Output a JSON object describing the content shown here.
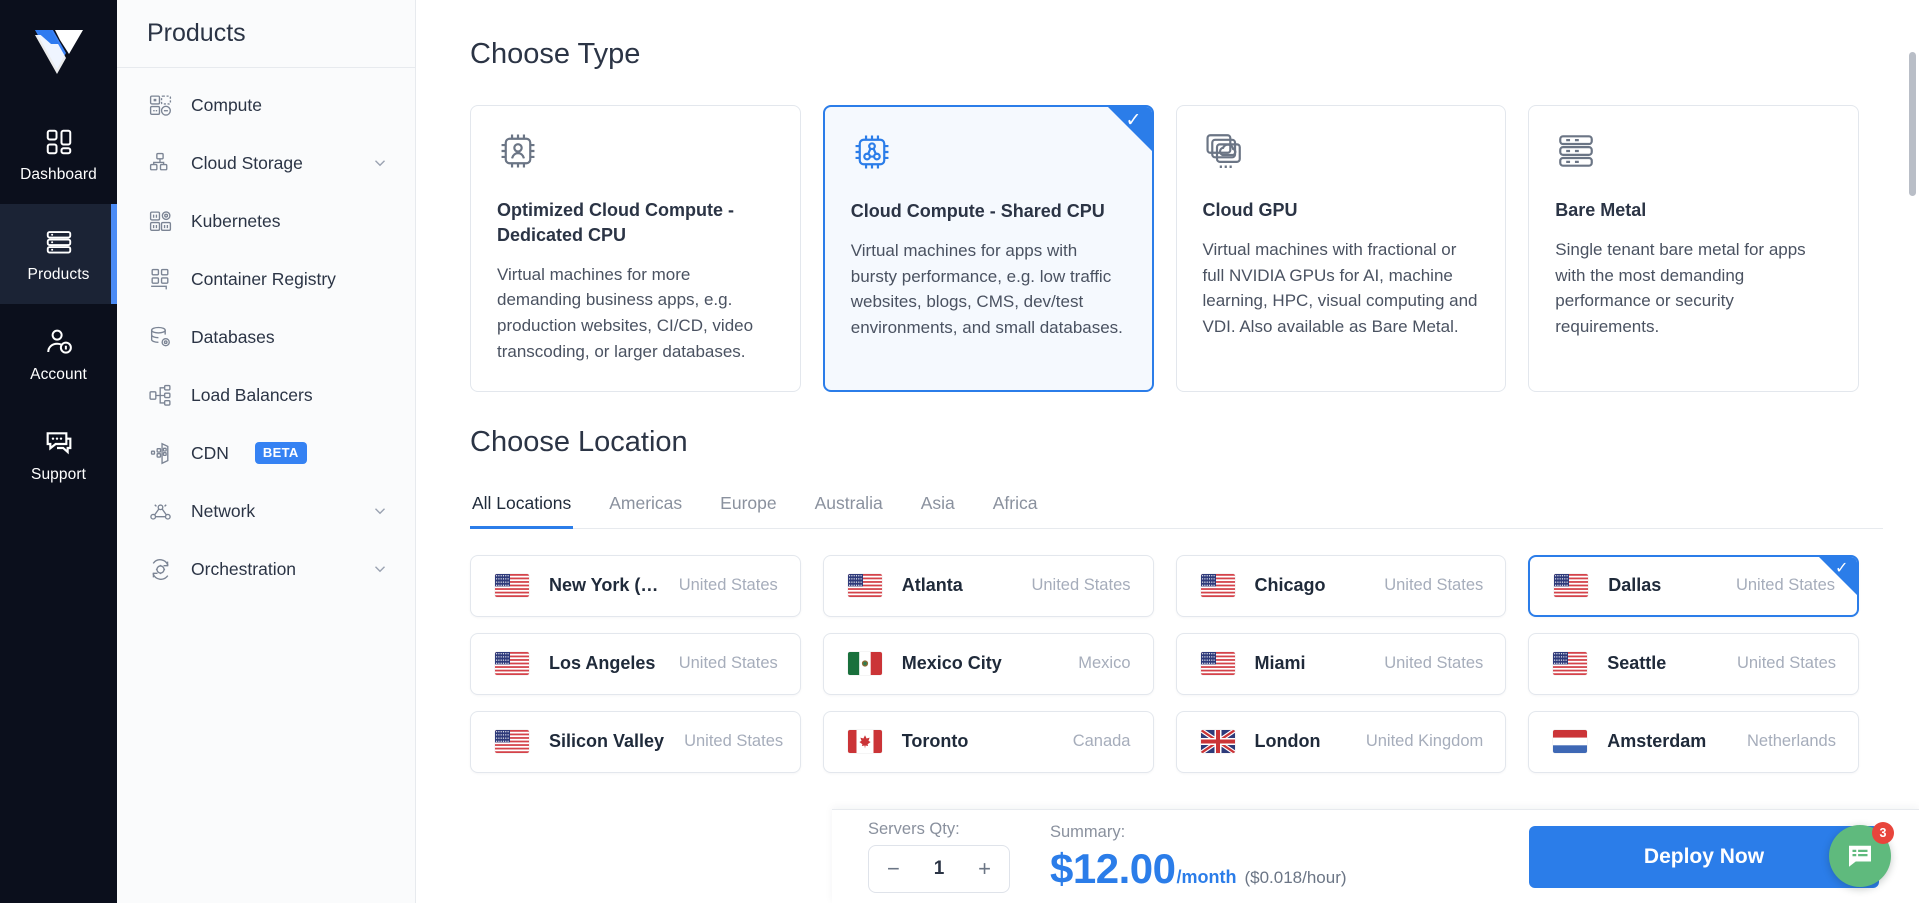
{
  "rail": {
    "logo_name": "vultr-logo",
    "items": [
      {
        "label": "Dashboard",
        "icon": "dashboard-icon",
        "active": false
      },
      {
        "label": "Products",
        "icon": "server-stack-icon",
        "active": true
      },
      {
        "label": "Account",
        "icon": "account-icon",
        "active": false
      },
      {
        "label": "Support",
        "icon": "chat-support-icon",
        "active": false
      }
    ]
  },
  "products_panel": {
    "title": "Products",
    "items": [
      {
        "label": "Compute",
        "icon": "compute-icon",
        "chevron": false,
        "badge": ""
      },
      {
        "label": "Cloud Storage",
        "icon": "cloud-storage-icon",
        "chevron": true,
        "badge": ""
      },
      {
        "label": "Kubernetes",
        "icon": "kubernetes-icon",
        "chevron": false,
        "badge": ""
      },
      {
        "label": "Container Registry",
        "icon": "container-registry-icon",
        "chevron": false,
        "badge": ""
      },
      {
        "label": "Databases",
        "icon": "databases-icon",
        "chevron": false,
        "badge": ""
      },
      {
        "label": "Load Balancers",
        "icon": "load-balancers-icon",
        "chevron": false,
        "badge": ""
      },
      {
        "label": "CDN",
        "icon": "cdn-icon",
        "chevron": false,
        "badge": "BETA"
      },
      {
        "label": "Network",
        "icon": "network-icon",
        "chevron": true,
        "badge": ""
      },
      {
        "label": "Orchestration",
        "icon": "orchestration-icon",
        "chevron": true,
        "badge": ""
      }
    ]
  },
  "main": {
    "choose_type_title": "Choose Type",
    "type_cards": [
      {
        "title": "Optimized Cloud Compute - Dedicated CPU",
        "desc": "Virtual machines for more demanding business apps, e.g. production websites, CI/CD, video transcoding, or larger databases.",
        "icon": "cpu-user-icon",
        "selected": false
      },
      {
        "title": "Cloud Compute - Shared CPU",
        "desc": "Virtual machines for apps with bursty performance, e.g. low traffic websites, blogs, CMS, dev/test environments, and small databases.",
        "icon": "cpu-share-icon",
        "selected": true
      },
      {
        "title": "Cloud GPU",
        "desc": "Virtual machines with fractional or full NVIDIA GPUs for AI, machine learning, HPC, visual computing and VDI. Also available as Bare Metal.",
        "icon": "gpu-cloud-icon",
        "selected": false
      },
      {
        "title": "Bare Metal",
        "desc": "Single tenant bare metal for apps with the most demanding performance or security requirements.",
        "icon": "bare-metal-icon",
        "selected": false
      }
    ],
    "choose_location_title": "Choose Location",
    "location_tabs": [
      {
        "label": "All Locations",
        "active": true
      },
      {
        "label": "Americas",
        "active": false
      },
      {
        "label": "Europe",
        "active": false
      },
      {
        "label": "Australia",
        "active": false
      },
      {
        "label": "Asia",
        "active": false
      },
      {
        "label": "Africa",
        "active": false
      }
    ],
    "locations": [
      {
        "city": "New York (…",
        "country": "United States",
        "flag": "us",
        "selected": false
      },
      {
        "city": "Atlanta",
        "country": "United States",
        "flag": "us",
        "selected": false
      },
      {
        "city": "Chicago",
        "country": "United States",
        "flag": "us",
        "selected": false
      },
      {
        "city": "Dallas",
        "country": "United States",
        "flag": "us",
        "selected": true
      },
      {
        "city": "Los Angeles",
        "country": "United States",
        "flag": "us",
        "selected": false
      },
      {
        "city": "Mexico City",
        "country": "Mexico",
        "flag": "mx",
        "selected": false
      },
      {
        "city": "Miami",
        "country": "United States",
        "flag": "us",
        "selected": false
      },
      {
        "city": "Seattle",
        "country": "United States",
        "flag": "us",
        "selected": false
      },
      {
        "city": "Silicon Valley",
        "country": "United States",
        "flag": "us",
        "selected": false
      },
      {
        "city": "Toronto",
        "country": "Canada",
        "flag": "ca",
        "selected": false
      },
      {
        "city": "London",
        "country": "United Kingdom",
        "flag": "gb",
        "selected": false
      },
      {
        "city": "Amsterdam",
        "country": "Netherlands",
        "flag": "nl",
        "selected": false
      }
    ]
  },
  "bottom_bar": {
    "qty_label": "Servers Qty:",
    "qty_value": "1",
    "minus": "−",
    "plus": "+",
    "summary_label": "Summary:",
    "price": "$12.00",
    "per_unit": "/month",
    "hourly": "($0.018/hour)",
    "deploy_label": "Deploy Now"
  },
  "chat": {
    "badge": "3",
    "icon": "chat-message-icon"
  },
  "colors": {
    "accent": "#2b7de9",
    "rail_bg": "#0b0f1c",
    "beta_badge": "#3582f3",
    "chat_fab": "#5fba7d",
    "chat_badge": "#e8453c"
  }
}
